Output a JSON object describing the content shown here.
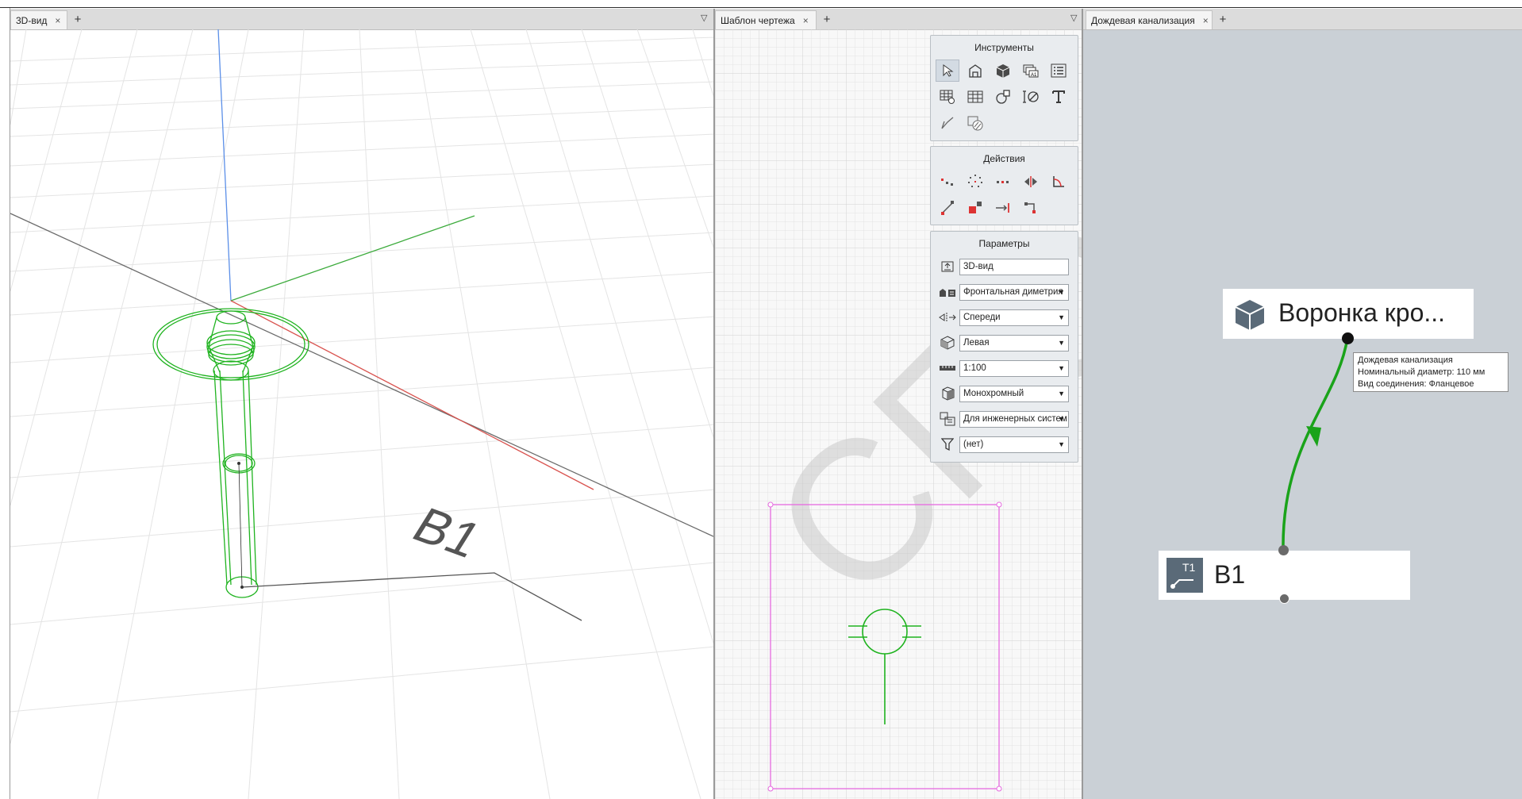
{
  "panes": {
    "left_tab": "3D-вид",
    "middle_tab": "Шаблон чертежа",
    "right_tab": "Дождевая канализация"
  },
  "tab_close_glyph": "×",
  "tab_add_glyph": "+",
  "tab_menu_glyph": "▽",
  "view3d": {
    "label": "B1",
    "model_color": "#1fb31f",
    "axis_colors": {
      "x": "#d9534f",
      "y": "#3cab3c",
      "z": "#5b8fe8"
    }
  },
  "watermark": "СПО",
  "tools": {
    "header": "Инструменты",
    "icons": [
      "select-icon",
      "building-icon",
      "box-3d-icon",
      "sheets-icon",
      "list-icon",
      "spec-table-icon",
      "table-icon",
      "shapes-icon",
      "dimension-icon",
      "text-icon",
      "polyline-icon",
      "hatch-icon"
    ]
  },
  "actions": {
    "header": "Действия",
    "icons": [
      "move-icon",
      "rotate-icon",
      "array-icon",
      "mirror-icon",
      "angle-icon",
      "stretch-icon",
      "scale-icon",
      "extend-icon",
      "connect-icon"
    ]
  },
  "params": {
    "header": "Параметры",
    "name_value": "3D-вид",
    "projection": "Фронтальная диметрия",
    "direction": "Спереди",
    "side": "Левая",
    "scale": "1:100",
    "style": "Монохромный",
    "preset": "Для инженерных систем",
    "filter": "(нет)",
    "dropdown_arrow": "▼"
  },
  "sheet": {
    "frame_color": "#e66ae0",
    "symbol_color": "#1fb31f"
  },
  "graph": {
    "node_top_label": "Воронка кро...",
    "node_bottom_label": "B1",
    "node_bottom_badge": "T1",
    "edge_color": "#1aa31a",
    "tooltip": {
      "line1": "Дождевая канализация",
      "line2": "Номинальный диаметр: 110 мм",
      "line3": "Вид соединения: Фланцевое"
    }
  }
}
